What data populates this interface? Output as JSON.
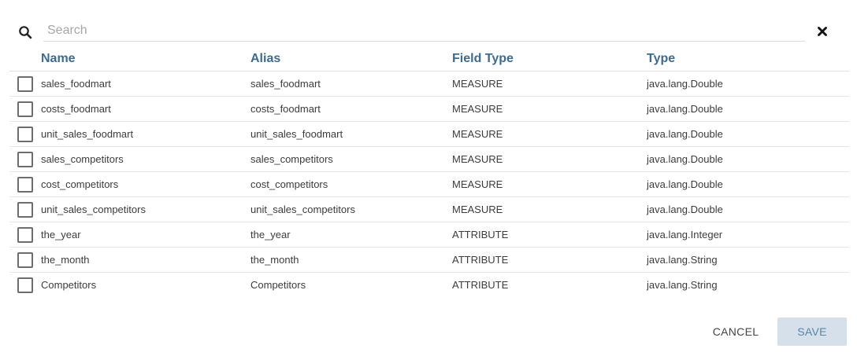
{
  "search": {
    "placeholder": "Search"
  },
  "table": {
    "headers": {
      "name": "Name",
      "alias": "Alias",
      "field_type": "Field Type",
      "type": "Type"
    },
    "rows": [
      {
        "name": "sales_foodmart",
        "alias": "sales_foodmart",
        "field_type": "MEASURE",
        "type": "java.lang.Double",
        "checked": false
      },
      {
        "name": "costs_foodmart",
        "alias": "costs_foodmart",
        "field_type": "MEASURE",
        "type": "java.lang.Double",
        "checked": false
      },
      {
        "name": "unit_sales_foodmart",
        "alias": "unit_sales_foodmart",
        "field_type": "MEASURE",
        "type": "java.lang.Double",
        "checked": false
      },
      {
        "name": "sales_competitors",
        "alias": "sales_competitors",
        "field_type": "MEASURE",
        "type": "java.lang.Double",
        "checked": false
      },
      {
        "name": "cost_competitors",
        "alias": "cost_competitors",
        "field_type": "MEASURE",
        "type": "java.lang.Double",
        "checked": false
      },
      {
        "name": "unit_sales_competitors",
        "alias": "unit_sales_competitors",
        "field_type": "MEASURE",
        "type": "java.lang.Double",
        "checked": false
      },
      {
        "name": "the_year",
        "alias": "the_year",
        "field_type": "ATTRIBUTE",
        "type": "java.lang.Integer",
        "checked": false
      },
      {
        "name": "the_month",
        "alias": "the_month",
        "field_type": "ATTRIBUTE",
        "type": "java.lang.String",
        "checked": false
      },
      {
        "name": "Competitors",
        "alias": "Competitors",
        "field_type": "ATTRIBUTE",
        "type": "java.lang.String",
        "checked": false
      }
    ]
  },
  "actions": {
    "cancel_label": "CANCEL",
    "save_label": "SAVE"
  },
  "colors": {
    "header_text": "#3e6b8e",
    "save_bg": "#d5e0eb",
    "save_text": "#5b84ab"
  },
  "icons": {
    "search": "search-icon",
    "close": "close-icon",
    "checkbox": "checkbox-unchecked"
  }
}
